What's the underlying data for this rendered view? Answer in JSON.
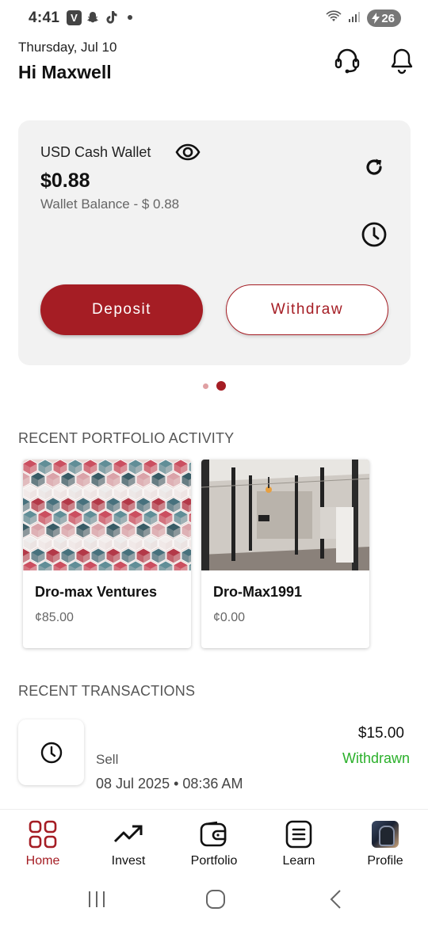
{
  "status_bar": {
    "time": "4:41",
    "app_icon_v": "V",
    "battery": "26"
  },
  "header": {
    "date": "Thursday, Jul 10",
    "greeting": "Hi Maxwell"
  },
  "wallet": {
    "title": "USD Cash Wallet",
    "amount": "$0.88",
    "balance_label": "Wallet Balance - $ 0.88",
    "deposit_label": "Deposit",
    "withdraw_label": "Withdraw",
    "pager_active_index": 1,
    "pager_count": 2
  },
  "portfolio": {
    "section_title": "RECENT PORTFOLIO ACTIVITY",
    "items": [
      {
        "name": "Dro-max Ventures",
        "value": "¢85.00"
      },
      {
        "name": "Dro-Max1991",
        "value": "¢0.00"
      }
    ]
  },
  "transactions": {
    "section_title": "RECENT TRANSACTIONS",
    "items": [
      {
        "type": "Sell",
        "date": "08 Jul 2025 • 08:36 AM",
        "amount": "$15.00",
        "status": "Withdrawn"
      }
    ]
  },
  "bottom_nav": {
    "items": [
      {
        "label": "Home",
        "icon": "home-grid-icon",
        "active": true
      },
      {
        "label": "Invest",
        "icon": "trending-up-icon",
        "active": false
      },
      {
        "label": "Portfolio",
        "icon": "wallet-icon",
        "active": false
      },
      {
        "label": "Learn",
        "icon": "book-icon",
        "active": false
      },
      {
        "label": "Profile",
        "icon": "avatar",
        "active": false
      }
    ]
  },
  "colors": {
    "accent": "#a51d24",
    "success": "#2bb02b",
    "card_bg": "#f2f2f2"
  }
}
